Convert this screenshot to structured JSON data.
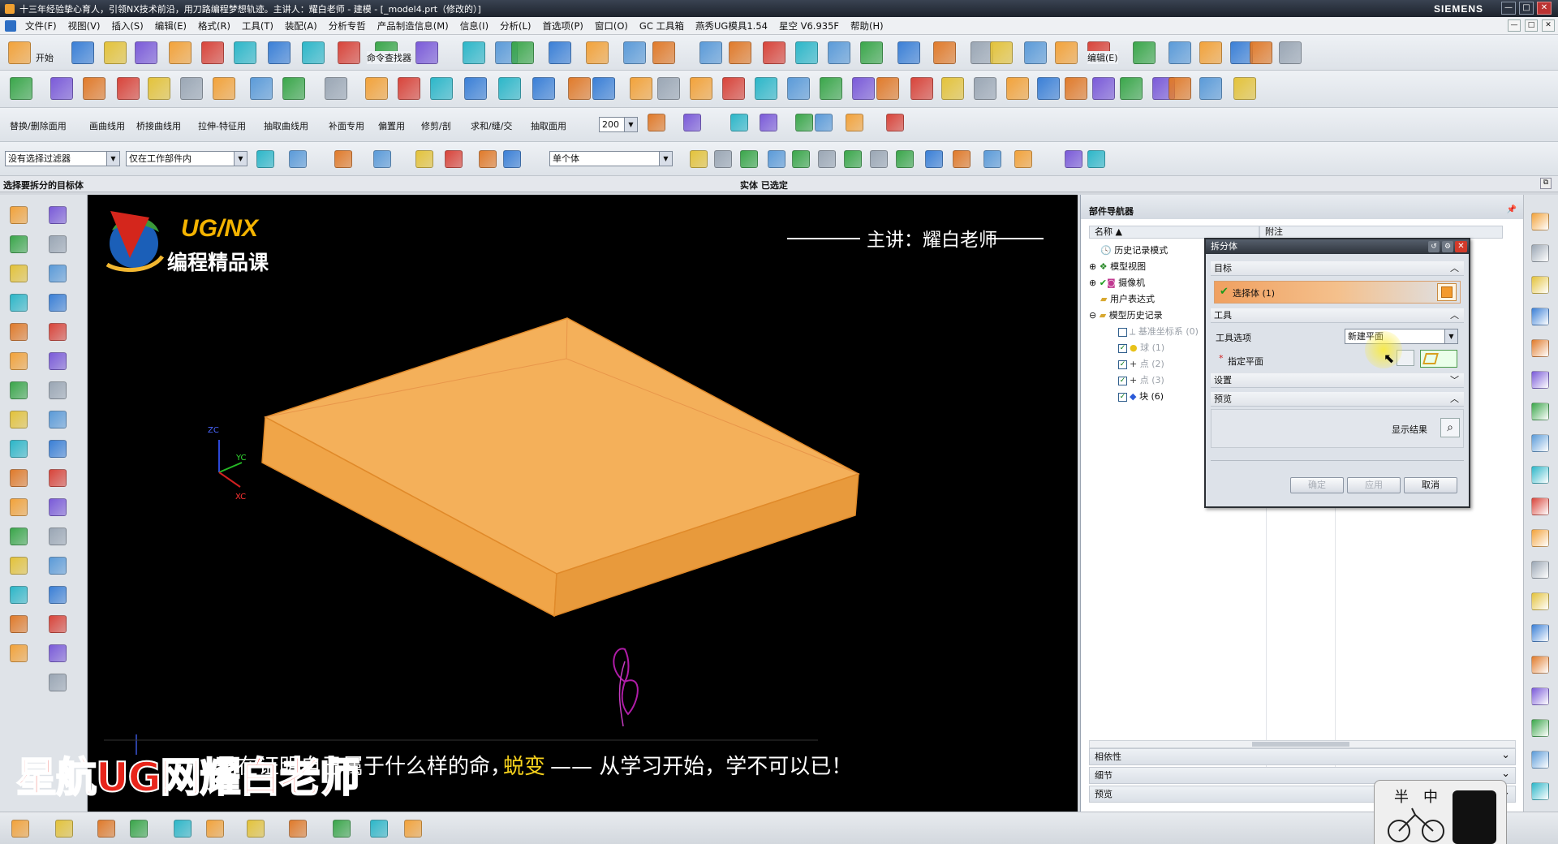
{
  "window": {
    "title": "十三年经验挚心育人，引领NX技术前沿，用刀路编程梦想轨迹。主讲人：耀白老师 - 建模 - [_model4.prt（修改的）]",
    "brand": "SIEMENS",
    "controls": [
      "—",
      "□",
      "✕"
    ]
  },
  "menu": [
    "文件(F)",
    "视图(V)",
    "插入(S)",
    "编辑(E)",
    "格式(R)",
    "工具(T)",
    "装配(A)",
    "分析专哲",
    "产品制造信息(M)",
    "信息(I)",
    "分析(L)",
    "首选项(P)",
    "窗口(O)",
    "GC 工具箱",
    "燕秀UG模具1.54",
    "星空 V6.935F",
    "帮助(H)"
  ],
  "toolbar1": {
    "start_label": "开始",
    "cmd_finder": "命令查找器",
    "edit_label": "编辑(E)"
  },
  "toolbar3": {
    "menus": [
      "替换/删除面用",
      "画曲线用",
      "桥接曲线用",
      "拉伸-特征用",
      "抽取曲线用",
      "补面专用",
      "偏置用",
      "修剪/剖",
      "求和/缝/交",
      "抽取面用"
    ],
    "zoom_value": "200"
  },
  "selection_bar": {
    "filter": "没有选择过滤器",
    "scope": "仅在工作部件内",
    "body_rule": "单个体"
  },
  "status": {
    "prompt": "选择要拆分的目标体",
    "state": "实体 已选定"
  },
  "viewport": {
    "logo_top": "UG/NX",
    "logo_bottom": "编程精品课",
    "teacher": "主讲：耀白老师",
    "axis_labels": [
      "ZC",
      "YC",
      "XC"
    ],
    "caption_pre": "是在证明自己属于什么样的命，",
    "caption_highlight": "蜕变",
    "caption_post": "—— 从学习开始，学不可以已！",
    "watermark": "星航UG网耀白老师",
    "colors": {
      "solid_face": "#f4ae52",
      "caption_highlight": "#f7d21c",
      "watermark": "#e8251b"
    }
  },
  "navigator": {
    "title": "部件导航器",
    "col_name": "名称",
    "col_note": "附注",
    "tree": {
      "history_mode": "历史记录模式",
      "model_views": "模型视图",
      "cameras": "摄像机",
      "user_exprs": "用户表达式",
      "model_history": "模型历史记录",
      "datum_csys": "基准坐标系 (0)",
      "sphere": "球 (1)",
      "point2": "点 (2)",
      "point3": "点 (3)",
      "block": "块 (6)"
    },
    "panels": [
      "相依性",
      "细节",
      "预览"
    ]
  },
  "dialog": {
    "title": "拆分体",
    "sec_target": "目标",
    "select_body": "选择体 (1)",
    "sec_tool": "工具",
    "tool_option_label": "工具选项",
    "tool_option_value": "新建平面",
    "specify_plane": "指定平面",
    "sec_settings": "设置",
    "sec_preview": "预览",
    "show_result": "显示结果",
    "ok": "确定",
    "apply": "应用",
    "cancel": "取消"
  },
  "stamp": {
    "left_char": "半",
    "right_char": "中"
  }
}
